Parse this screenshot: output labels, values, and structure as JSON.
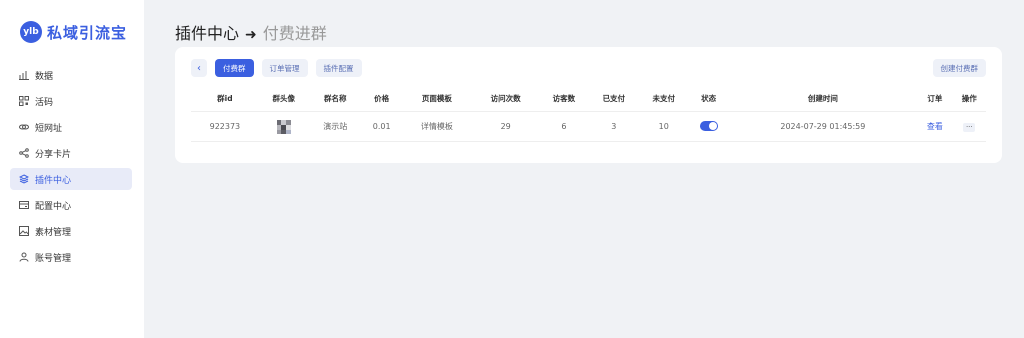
{
  "brand": {
    "badge": "ylb",
    "name": "私域引流宝",
    "color": "#3b5fe0"
  },
  "sidebar": {
    "items": [
      {
        "label": "数据",
        "icon": "chart-icon",
        "active": false
      },
      {
        "label": "活码",
        "icon": "qrcode-icon",
        "active": false
      },
      {
        "label": "短网址",
        "icon": "link-icon",
        "active": false
      },
      {
        "label": "分享卡片",
        "icon": "share-icon",
        "active": false
      },
      {
        "label": "插件中心",
        "icon": "layers-icon",
        "active": true
      },
      {
        "label": "配置中心",
        "icon": "config-icon",
        "active": false
      },
      {
        "label": "素材管理",
        "icon": "image-icon",
        "active": false
      },
      {
        "label": "账号管理",
        "icon": "user-icon",
        "active": false
      }
    ]
  },
  "header": {
    "title": "插件中心",
    "arrow": "➜",
    "subtitle": "付费进群"
  },
  "toolbar": {
    "tabs": [
      {
        "label": "付费群",
        "active": true
      },
      {
        "label": "订单管理",
        "active": false
      },
      {
        "label": "插件配置",
        "active": false
      }
    ],
    "create_label": "创建付费群"
  },
  "table": {
    "columns": [
      "群id",
      "群头像",
      "群名称",
      "价格",
      "页面模板",
      "访问次数",
      "访客数",
      "已支付",
      "未支付",
      "状态",
      "创建时间",
      "订单",
      "操作"
    ],
    "rows": [
      {
        "id": "922373",
        "name": "演示站",
        "price": "0.01",
        "template": "详情模板",
        "visits": "29",
        "visitors": "6",
        "paid": "3",
        "unpaid": "10",
        "status_on": true,
        "created": "2024-07-29 01:45:59",
        "order_link": "查看",
        "action": "..."
      }
    ]
  },
  "colors": {
    "accent": "#3b5fe0",
    "background": "#f0f2f5",
    "active_nav_bg": "#e8ebf8"
  }
}
